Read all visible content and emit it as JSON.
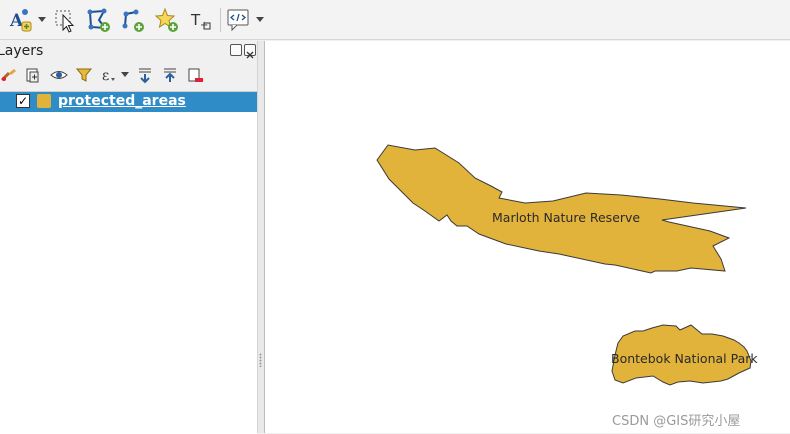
{
  "toolbar": {
    "buttons": [
      {
        "name": "label-tool-icon"
      },
      {
        "name": "select-features-icon"
      },
      {
        "name": "add-polygon-icon"
      },
      {
        "name": "add-line-icon"
      },
      {
        "name": "add-point-icon"
      },
      {
        "name": "text-annotation-icon"
      },
      {
        "name": "map-tips-icon"
      }
    ]
  },
  "layers_panel": {
    "title": "Layers",
    "tools": [
      "style-brush-icon",
      "add-group-icon",
      "visibility-eye-icon",
      "filter-icon",
      "expression-filter-icon",
      "expand-all-icon",
      "collapse-all-icon",
      "remove-layer-icon"
    ],
    "layers": [
      {
        "name": "protected_areas",
        "checked": true,
        "check_mark": "✓",
        "color": "#e2b33a",
        "selected": true
      }
    ]
  },
  "map": {
    "fill_color": "#e2b33a",
    "stroke_color": "#3a3a3a",
    "features": [
      {
        "label": "Marloth Nature Reserve"
      },
      {
        "label": "Bontebok National Park"
      }
    ]
  },
  "watermark": "CSDN @GIS研究小屋"
}
